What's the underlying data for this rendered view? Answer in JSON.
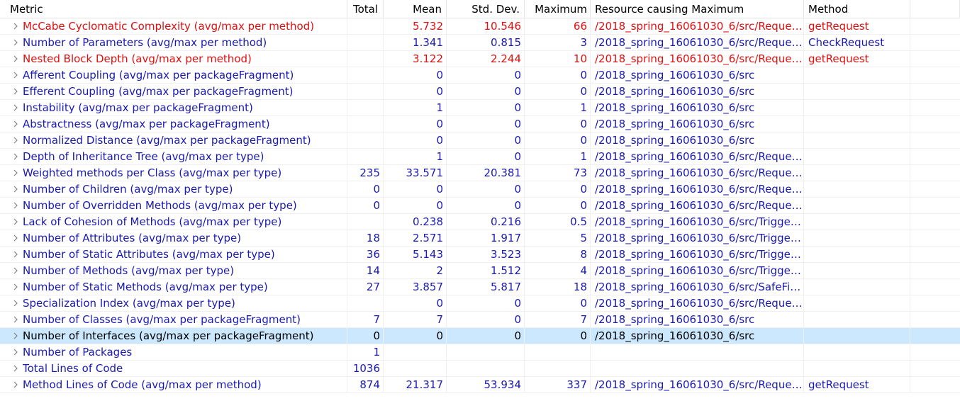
{
  "headers": {
    "metric": "Metric",
    "total": "Total",
    "mean": "Mean",
    "std": "Std. Dev.",
    "max": "Maximum",
    "resource": "Resource causing Maximum",
    "method": "Method"
  },
  "colors": {
    "normal": "#1a1ab3",
    "warning": "#e01010",
    "selected_bg": "#cce8ff"
  },
  "rows": [
    {
      "metric": "McCabe Cyclomatic Complexity (avg/max per method)",
      "total": "",
      "mean": "5.732",
      "std": "10.546",
      "max": "66",
      "resource": "/2018_spring_16061030_6/src/Reques...",
      "method": "getRequest",
      "status": "red"
    },
    {
      "metric": "Number of Parameters (avg/max per method)",
      "total": "",
      "mean": "1.341",
      "std": "0.815",
      "max": "3",
      "resource": "/2018_spring_16061030_6/src/Reques...",
      "method": "CheckRequest",
      "status": "blue"
    },
    {
      "metric": "Nested Block Depth (avg/max per method)",
      "total": "",
      "mean": "3.122",
      "std": "2.244",
      "max": "10",
      "resource": "/2018_spring_16061030_6/src/Reques...",
      "method": "getRequest",
      "status": "red"
    },
    {
      "metric": "Afferent Coupling (avg/max per packageFragment)",
      "total": "",
      "mean": "0",
      "std": "0",
      "max": "0",
      "resource": "/2018_spring_16061030_6/src",
      "method": "",
      "status": "blue"
    },
    {
      "metric": "Efferent Coupling (avg/max per packageFragment)",
      "total": "",
      "mean": "0",
      "std": "0",
      "max": "0",
      "resource": "/2018_spring_16061030_6/src",
      "method": "",
      "status": "blue"
    },
    {
      "metric": "Instability (avg/max per packageFragment)",
      "total": "",
      "mean": "1",
      "std": "0",
      "max": "1",
      "resource": "/2018_spring_16061030_6/src",
      "method": "",
      "status": "blue"
    },
    {
      "metric": "Abstractness (avg/max per packageFragment)",
      "total": "",
      "mean": "0",
      "std": "0",
      "max": "0",
      "resource": "/2018_spring_16061030_6/src",
      "method": "",
      "status": "blue"
    },
    {
      "metric": "Normalized Distance (avg/max per packageFragment)",
      "total": "",
      "mean": "0",
      "std": "0",
      "max": "0",
      "resource": "/2018_spring_16061030_6/src",
      "method": "",
      "status": "blue"
    },
    {
      "metric": "Depth of Inheritance Tree (avg/max per type)",
      "total": "",
      "mean": "1",
      "std": "0",
      "max": "1",
      "resource": "/2018_spring_16061030_6/src/Reques...",
      "method": "",
      "status": "blue"
    },
    {
      "metric": "Weighted methods per Class (avg/max per type)",
      "total": "235",
      "mean": "33.571",
      "std": "20.381",
      "max": "73",
      "resource": "/2018_spring_16061030_6/src/Reques...",
      "method": "",
      "status": "blue"
    },
    {
      "metric": "Number of Children (avg/max per type)",
      "total": "0",
      "mean": "0",
      "std": "0",
      "max": "0",
      "resource": "/2018_spring_16061030_6/src/Reques...",
      "method": "",
      "status": "blue"
    },
    {
      "metric": "Number of Overridden Methods (avg/max per type)",
      "total": "0",
      "mean": "0",
      "std": "0",
      "max": "0",
      "resource": "/2018_spring_16061030_6/src/Reques...",
      "method": "",
      "status": "blue"
    },
    {
      "metric": "Lack of Cohesion of Methods (avg/max per type)",
      "total": "",
      "mean": "0.238",
      "std": "0.216",
      "max": "0.5",
      "resource": "/2018_spring_16061030_6/src/Trigger...",
      "method": "",
      "status": "blue"
    },
    {
      "metric": "Number of Attributes (avg/max per type)",
      "total": "18",
      "mean": "2.571",
      "std": "1.917",
      "max": "5",
      "resource": "/2018_spring_16061030_6/src/Trigger...",
      "method": "",
      "status": "blue"
    },
    {
      "metric": "Number of Static Attributes (avg/max per type)",
      "total": "36",
      "mean": "5.143",
      "std": "3.523",
      "max": "8",
      "resource": "/2018_spring_16061030_6/src/Trigger...",
      "method": "",
      "status": "blue"
    },
    {
      "metric": "Number of Methods (avg/max per type)",
      "total": "14",
      "mean": "2",
      "std": "1.512",
      "max": "4",
      "resource": "/2018_spring_16061030_6/src/Trigger...",
      "method": "",
      "status": "blue"
    },
    {
      "metric": "Number of Static Methods (avg/max per type)",
      "total": "27",
      "mean": "3.857",
      "std": "5.817",
      "max": "18",
      "resource": "/2018_spring_16061030_6/src/SafeFile...",
      "method": "",
      "status": "blue"
    },
    {
      "metric": "Specialization Index (avg/max per type)",
      "total": "",
      "mean": "0",
      "std": "0",
      "max": "0",
      "resource": "/2018_spring_16061030_6/src/Reques...",
      "method": "",
      "status": "blue"
    },
    {
      "metric": "Number of Classes (avg/max per packageFragment)",
      "total": "7",
      "mean": "7",
      "std": "0",
      "max": "7",
      "resource": "/2018_spring_16061030_6/src",
      "method": "",
      "status": "blue"
    },
    {
      "metric": "Number of Interfaces (avg/max per packageFragment)",
      "total": "0",
      "mean": "0",
      "std": "0",
      "max": "0",
      "resource": "/2018_spring_16061030_6/src",
      "method": "",
      "status": "blue",
      "selected": true
    },
    {
      "metric": "Number of Packages",
      "total": "1",
      "mean": "",
      "std": "",
      "max": "",
      "resource": "",
      "method": "",
      "status": "blue"
    },
    {
      "metric": "Total Lines of Code",
      "total": "1036",
      "mean": "",
      "std": "",
      "max": "",
      "resource": "",
      "method": "",
      "status": "blue"
    },
    {
      "metric": "Method Lines of Code (avg/max per method)",
      "total": "874",
      "mean": "21.317",
      "std": "53.934",
      "max": "337",
      "resource": "/2018_spring_16061030_6/src/Reques...",
      "method": "getRequest",
      "status": "blue"
    }
  ]
}
